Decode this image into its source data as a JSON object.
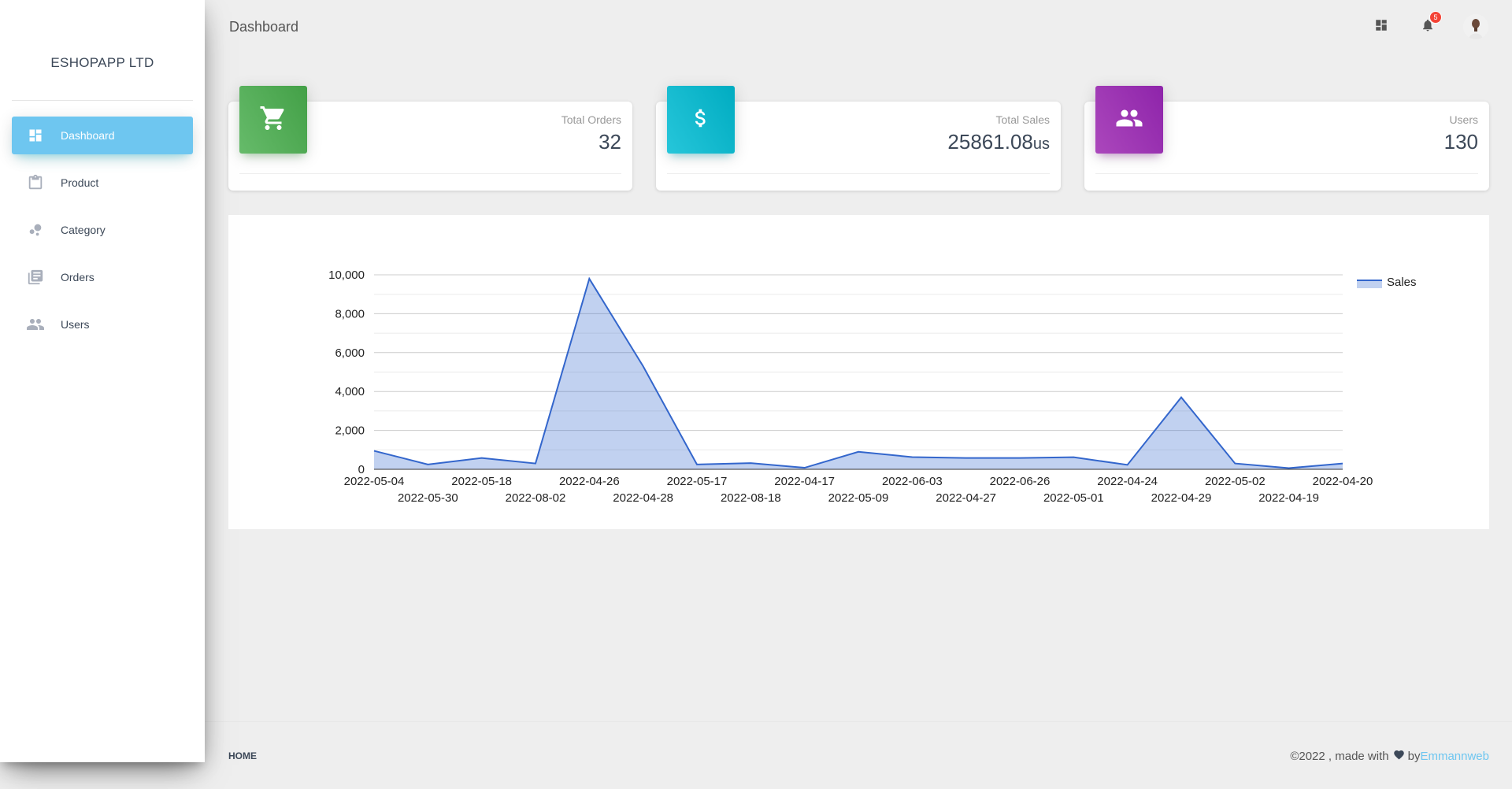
{
  "brand": {
    "name": "ESHOPAPP LTD"
  },
  "sidebar": {
    "items": [
      {
        "label": "Dashboard",
        "icon": "dashboard-icon",
        "active": true
      },
      {
        "label": "Product",
        "icon": "clipboard-icon",
        "active": false
      },
      {
        "label": "Category",
        "icon": "bubbles-icon",
        "active": false
      },
      {
        "label": "Orders",
        "icon": "library-books-icon",
        "active": false
      },
      {
        "label": "Users",
        "icon": "people-icon",
        "active": false
      }
    ]
  },
  "header": {
    "title": "Dashboard",
    "notifications_count": "5"
  },
  "cards": [
    {
      "category": "Total Orders",
      "value": "32",
      "unit": "",
      "icon": "cart-icon",
      "color": "#4caf50"
    },
    {
      "category": "Total Sales",
      "value": "25861.08",
      "unit": "us",
      "icon": "dollar-icon",
      "color": "#00bcd4"
    },
    {
      "category": "Users",
      "value": "130",
      "unit": "",
      "icon": "people-icon",
      "color": "#9c27b0"
    }
  ],
  "chart_data": {
    "type": "area",
    "x": [
      "2022-05-04",
      "2022-05-30",
      "2022-05-18",
      "2022-08-02",
      "2022-04-26",
      "2022-04-28",
      "2022-05-17",
      "2022-08-18",
      "2022-04-17",
      "2022-05-09",
      "2022-06-03",
      "2022-04-27",
      "2022-06-26",
      "2022-05-01",
      "2022-04-24",
      "2022-04-29",
      "2022-05-02",
      "2022-04-19",
      "2022-04-20"
    ],
    "series": [
      {
        "name": "Sales",
        "values": [
          950,
          250,
          580,
          300,
          9800,
          5300,
          250,
          320,
          80,
          900,
          630,
          580,
          580,
          620,
          230,
          3700,
          300,
          60,
          300
        ],
        "color": "#3366cc"
      }
    ],
    "ylim": [
      0,
      10000
    ],
    "yticks": [
      "0",
      "2,000",
      "4,000",
      "6,000",
      "8,000",
      "10,000"
    ],
    "legend": "right",
    "grid": true
  },
  "footer": {
    "home": "HOME",
    "copyright": "©2022 , made with",
    "by": "by",
    "author": "Emmannweb"
  }
}
